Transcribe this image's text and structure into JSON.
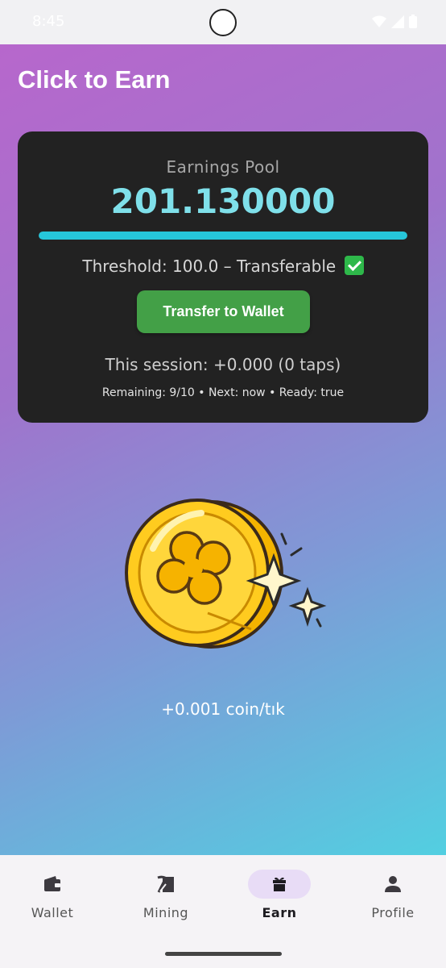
{
  "status_bar": {
    "time": "8:45"
  },
  "page": {
    "title": "Click to Earn"
  },
  "earnings_card": {
    "label": "Earnings Pool",
    "amount": "201.130000",
    "progress_fraction": 1.0,
    "threshold_text": "Threshold: 100.0 – Transferable",
    "transfer_button_label": "Transfer to Wallet",
    "session_text": "This session: +0.000 (0 taps)",
    "meta_text": "Remaining: 9/10 • Next: now • Ready: true"
  },
  "coin": {
    "icon": "clover-coin-icon",
    "rate_text": "+0.001 coin/tık"
  },
  "colors": {
    "accent_cyan": "#26c6da",
    "amount_text": "#7fe0ea",
    "button_green": "#43a047",
    "card_bg": "#222222",
    "active_nav_pill": "#e8dcf6"
  },
  "bottom_nav": {
    "items": [
      {
        "label": "Wallet",
        "icon": "wallet-icon"
      },
      {
        "label": "Mining",
        "icon": "pickaxe-icon"
      },
      {
        "label": "Earn",
        "icon": "gift-icon",
        "active": true
      },
      {
        "label": "Profile",
        "icon": "person-icon"
      }
    ]
  }
}
